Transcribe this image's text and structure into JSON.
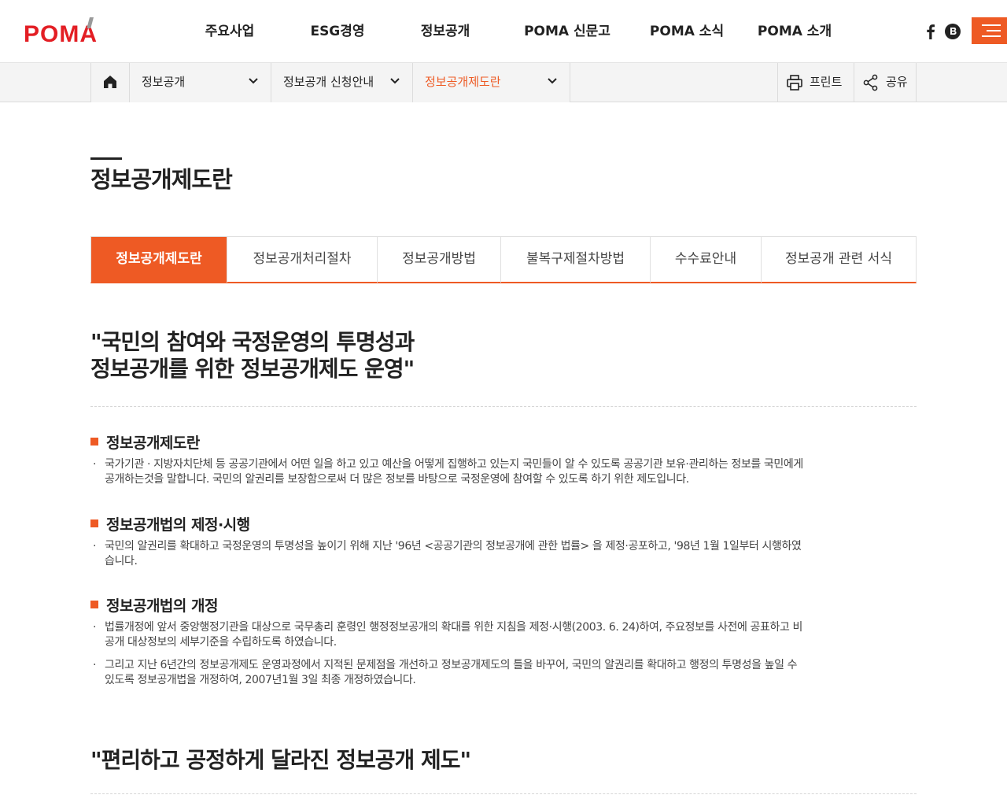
{
  "header": {
    "logo_text": "POMA",
    "nav": [
      "주요사업",
      "ESG경영",
      "정보공개",
      "POMA 신문고",
      "POMA 소식",
      "POMA 소개"
    ],
    "brand_color": "#ee5a24"
  },
  "location": {
    "home_icon": "home-icon",
    "dropdowns": [
      "정보공개",
      "정보공개 신청안내",
      "정보공개제도란"
    ],
    "print_label": "프린트",
    "share_label": "공유"
  },
  "page_title": "정보공개제도란",
  "tabs": [
    "정보공개제도란",
    "정보공개처리절차",
    "정보공개방법",
    "불복구제절차방법",
    "수수료안내",
    "정보공개 관련 서식"
  ],
  "headline": {
    "line1": "\"국민의 참여와 국정운영의 투명성과",
    "line2": "정보공개를 위한 정보공개제도 운영\""
  },
  "sections": [
    {
      "title": "정보공개제도란",
      "bullets": [
        [
          "국가기관 · 지방자치단체 등 공공기관에서 어떤 일을 하고 있고 예산을 어떻게 집행하고 있는지 국민들이 알 수 있도록 공공기관 보유·관리하는 정보를 국민에게",
          "공개하는것을 말합니다. 국민의 알권리를 보장함으로써 더 많은 정보를 바탕으로 국정운영에 참여할 수 있도록 하기 위한 제도입니다."
        ]
      ]
    },
    {
      "title": "정보공개법의 제정·시행",
      "bullets": [
        [
          "국민의 알권리를 확대하고 국정운영의 투명성을 높이기 위해 지난 '96년 <공공기관의 정보공개에 관한 법률> 을 제정·공포하고, '98년 1월 1일부터 시행하였",
          "습니다."
        ]
      ]
    },
    {
      "title": "정보공개법의 개정",
      "bullets": [
        [
          "법률개정에 앞서 중앙행정기관을 대상으로 국무총리 훈령인 행정정보공개의 확대를 위한 지침을 제정·시행(2003. 6. 24)하여, 주요정보를 사전에 공표하고 비",
          "공개 대상정보의 세부기준을 수립하도록 하였습니다."
        ],
        [
          "그리고 지난 6년간의 정보공개제도 운영과정에서 지적된 문제점을 개선하고 정보공개제도의 틀을 바꾸어, 국민의 알권리를 확대하고 행정의 투명성을 높일 수",
          "있도록 정보공개법을 개정하여, 2007년1월 3일 최종 개정하였습니다."
        ]
      ]
    }
  ],
  "headline2": "\"편리하고 공정하게 달라진 정보공개 제도\"",
  "bullet_mark": "·"
}
